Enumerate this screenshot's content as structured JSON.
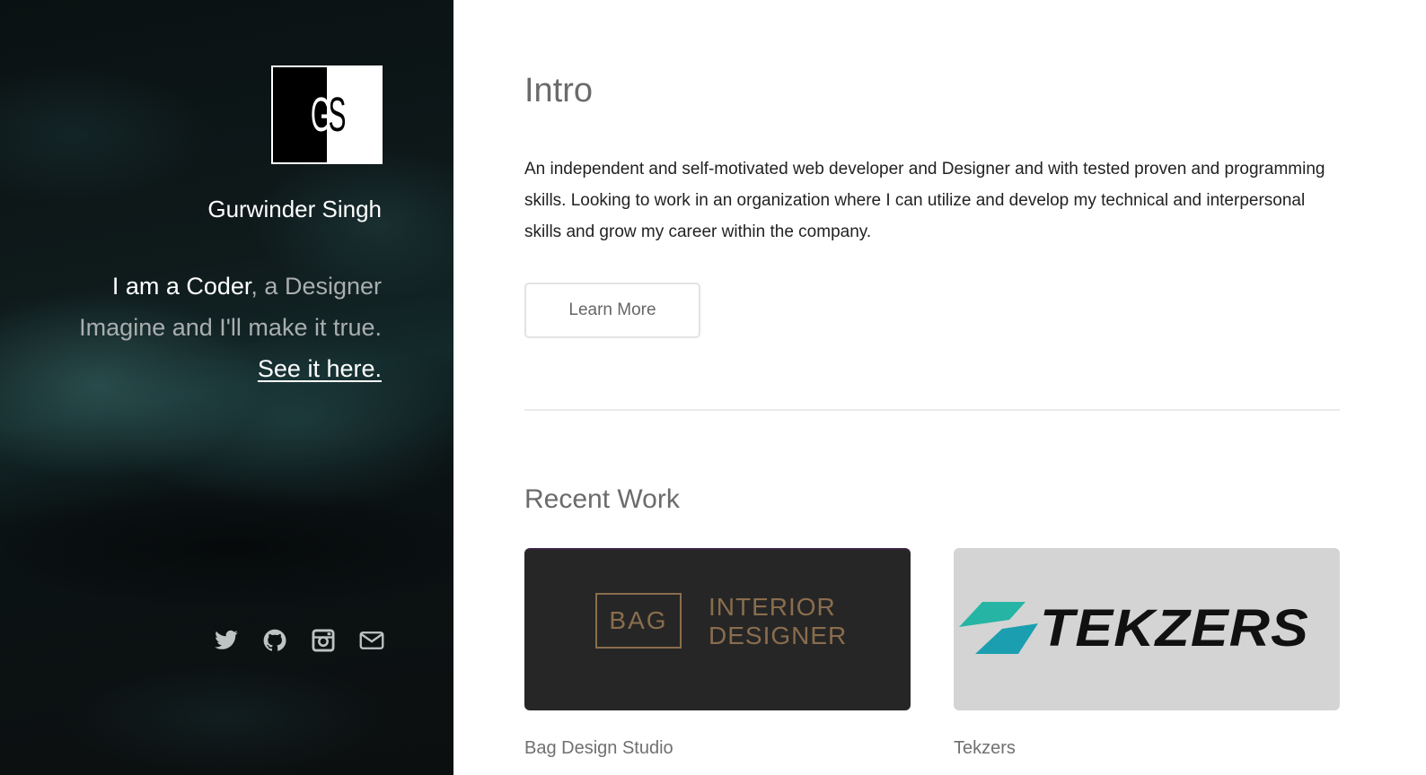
{
  "sidebar": {
    "avatar_monogram": {
      "left": "G",
      "right": "S"
    },
    "name": "Gurwinder Singh",
    "tagline": {
      "part1": "I am a Coder",
      "part2": ", a Designer",
      "line2": "Imagine and I'll make it true.",
      "link": "See it here."
    },
    "socials": [
      {
        "icon": "twitter-icon"
      },
      {
        "icon": "github-icon"
      },
      {
        "icon": "instagram-icon"
      },
      {
        "icon": "mail-icon"
      }
    ]
  },
  "main": {
    "intro": {
      "title": "Intro",
      "text": "An independent and self-motivated web developer and Designer and with tested proven and programming skills. Looking to work in an organization where I can utilize and develop my technical and interpersonal skills and grow my career within the company.",
      "button": "Learn More"
    },
    "recent": {
      "title": "Recent Work",
      "items": [
        {
          "name": "Bag Design Studio",
          "logo_box": "BAG",
          "logo_line1": "INTERIOR",
          "logo_line2": "DESIGNER"
        },
        {
          "name": "Tekzers",
          "logo_word": "TEKZERS"
        }
      ]
    }
  },
  "colors": {
    "sidebar_bg": "#0f1a1b",
    "heading_gray": "#6b6b6b",
    "bag_gold": "#8a6d4d",
    "tek_teal": "#1fa89a"
  }
}
